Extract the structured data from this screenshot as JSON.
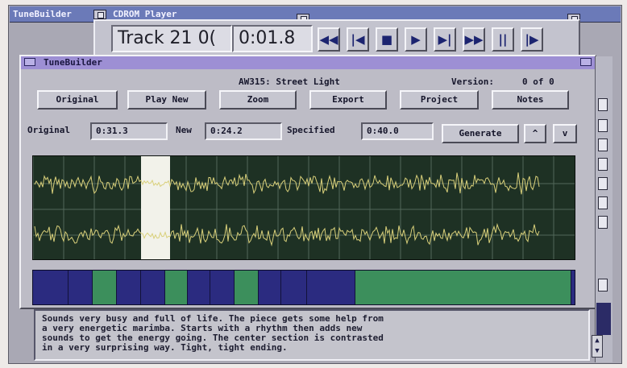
{
  "desktop": {
    "window_title": "TuneBuilder"
  },
  "cd_player": {
    "title": "CDROM Player",
    "track_text": "Track 21",
    "track_suffix": "0(",
    "time": "0:01.8",
    "buttons": [
      {
        "name": "rewind-button",
        "glyph": "◀◀"
      },
      {
        "name": "previous-track-button",
        "glyph": "|◀"
      },
      {
        "name": "stop-button",
        "glyph": "■"
      },
      {
        "name": "play-button",
        "glyph": "▶"
      },
      {
        "name": "next-track-button",
        "glyph": "▶|"
      },
      {
        "name": "fast-forward-button",
        "glyph": "▶▶"
      },
      {
        "name": "pause-button",
        "glyph": "||"
      },
      {
        "name": "step-forward-button",
        "glyph": "|▶"
      }
    ]
  },
  "tunebuilder": {
    "title": "TuneBuilder",
    "track_name": "AW315: Street Light",
    "version_label": "Version:",
    "version_value": "0 of  0",
    "buttons": {
      "original": "Original",
      "play_new": "Play New",
      "zoom": "Zoom",
      "export": "Export",
      "project": "Project",
      "notes": "Notes",
      "generate": "Generate",
      "up": "^",
      "down": "v"
    },
    "fields": {
      "original_label": "Original",
      "original_value": "0:31.3",
      "new_label": "New",
      "new_value": "0:24.2",
      "specified_label": "Specified",
      "specified_value": "0:40.0"
    },
    "colors": {
      "waveform_bg": "#1e3124",
      "waveform_trace": "#d9d07a",
      "selection": "#f2f2ea",
      "segment_blue": "#2b2b80",
      "segment_green": "#3c8f5c"
    }
  },
  "notes_text": [
    "Sounds very busy and full of life.  The piece gets some help from",
    "a very energetic marimba.  Starts with a rhythm then adds new",
    "sounds to get the energy going.  The center section is contrasted",
    "in a very surprising way.  Tight, tight ending."
  ]
}
